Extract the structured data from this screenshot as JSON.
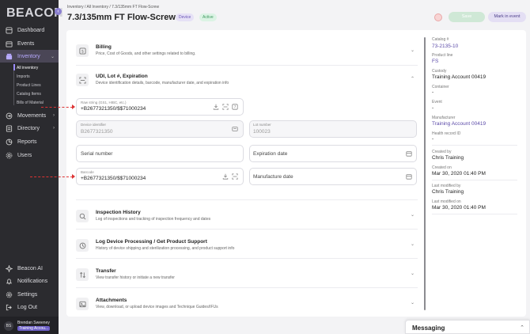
{
  "sidebar": {
    "logo": "BEACON",
    "collapse_icon": "chevron-left-icon",
    "items": [
      {
        "label": "Dashboard",
        "icon": "dashboard-icon"
      },
      {
        "label": "Events",
        "icon": "calendar-icon"
      },
      {
        "label": "Inventory",
        "icon": "box-icon"
      },
      {
        "label": "Movements",
        "icon": "arrows-icon"
      },
      {
        "label": "Directory",
        "icon": "folder-icon"
      },
      {
        "label": "Reports",
        "icon": "report-icon"
      },
      {
        "label": "Users",
        "icon": "users-icon"
      }
    ],
    "inventory_sub": [
      "All inventory",
      "Imports",
      "Product Lines",
      "Catalog Items",
      "Bills of Material"
    ],
    "bottom": [
      {
        "label": "Beacon AI",
        "icon": "sparkle-icon"
      },
      {
        "label": "Notifications",
        "icon": "bell-icon"
      },
      {
        "label": "Settings",
        "icon": "gear-icon"
      },
      {
        "label": "Log Out",
        "icon": "logout-icon"
      }
    ],
    "user": {
      "initials": "BS",
      "name": "Brendan Sweeney",
      "account": "Training Accou..."
    }
  },
  "header": {
    "breadcrumb": "Inventory  /  All Inventory  /  7.3/135mm FT Flow-Screw",
    "title": "7.3/135mm FT Flow-Screw",
    "badge_type": "Device",
    "badge_status": "Active",
    "save_label": "Save",
    "mark_label": "Mark in event"
  },
  "sections": {
    "billing": {
      "title": "Billing",
      "desc": "Price, Cost of Goods, and other settings related to billing."
    },
    "udi": {
      "title": "UDI, Lot #, Expiration",
      "desc": "Device identification details, barcode, manufacturer date, and expiration info"
    },
    "inspection": {
      "title": "Inspection History",
      "desc": "Log of inspections and tracking of inspection frequency and dates"
    },
    "processing": {
      "title": "Log Device Processing / Get Product Support",
      "desc": "History of device shipping and sterilization processing, and product support info"
    },
    "transfer": {
      "title": "Transfer",
      "desc": "View transfer history or initiate a new transfer"
    },
    "attachments": {
      "title": "Attachments",
      "desc": "View, download, or upload device images and Technique Guides/IFUs"
    }
  },
  "udi_fields": {
    "raw_label": "Raw string (GS1, HIBC, etc.)",
    "raw_value": "+B2677321350/$$71000234",
    "device_id_label": "Device identifier",
    "device_id_value": "B2677321350",
    "lot_label": "Lot number",
    "lot_value": "100023",
    "serial_placeholder": "Serial number",
    "expiration_placeholder": "Expiration date",
    "barcode_label": "Barcode",
    "barcode_value": "+B2677321350/$$71000234",
    "manufacture_placeholder": "Manufacture date"
  },
  "details": {
    "catalog_label": "Catalog #",
    "catalog_value": "73-2135-10",
    "product_line_label": "Product line",
    "product_line_value": "FS",
    "custody_label": "Custody",
    "custody_value": "Training Account 00419",
    "container_label": "Container",
    "container_value": "-",
    "event_label": "Event",
    "event_value": "-",
    "manufacturer_label": "Manufacturer",
    "manufacturer_value": "Training Account 00419",
    "health_label": "Health record ID",
    "health_value": "-",
    "created_by_label": "Created by",
    "created_by_value": "Chris Training",
    "created_on_label": "Created on",
    "created_on_value": "Mar 30, 2020 01:40 PM",
    "modified_by_label": "Last modified by",
    "modified_by_value": "Chris Training",
    "modified_on_label": "Last modified on",
    "modified_on_value": "Mar 30, 2020 01:40 PM"
  },
  "messaging": {
    "title": "Messaging"
  },
  "colors": {
    "accent": "#6c5fc7",
    "sidebar": "#2b2b2f",
    "link": "#5b4aa8",
    "arrow": "#dd3333"
  }
}
